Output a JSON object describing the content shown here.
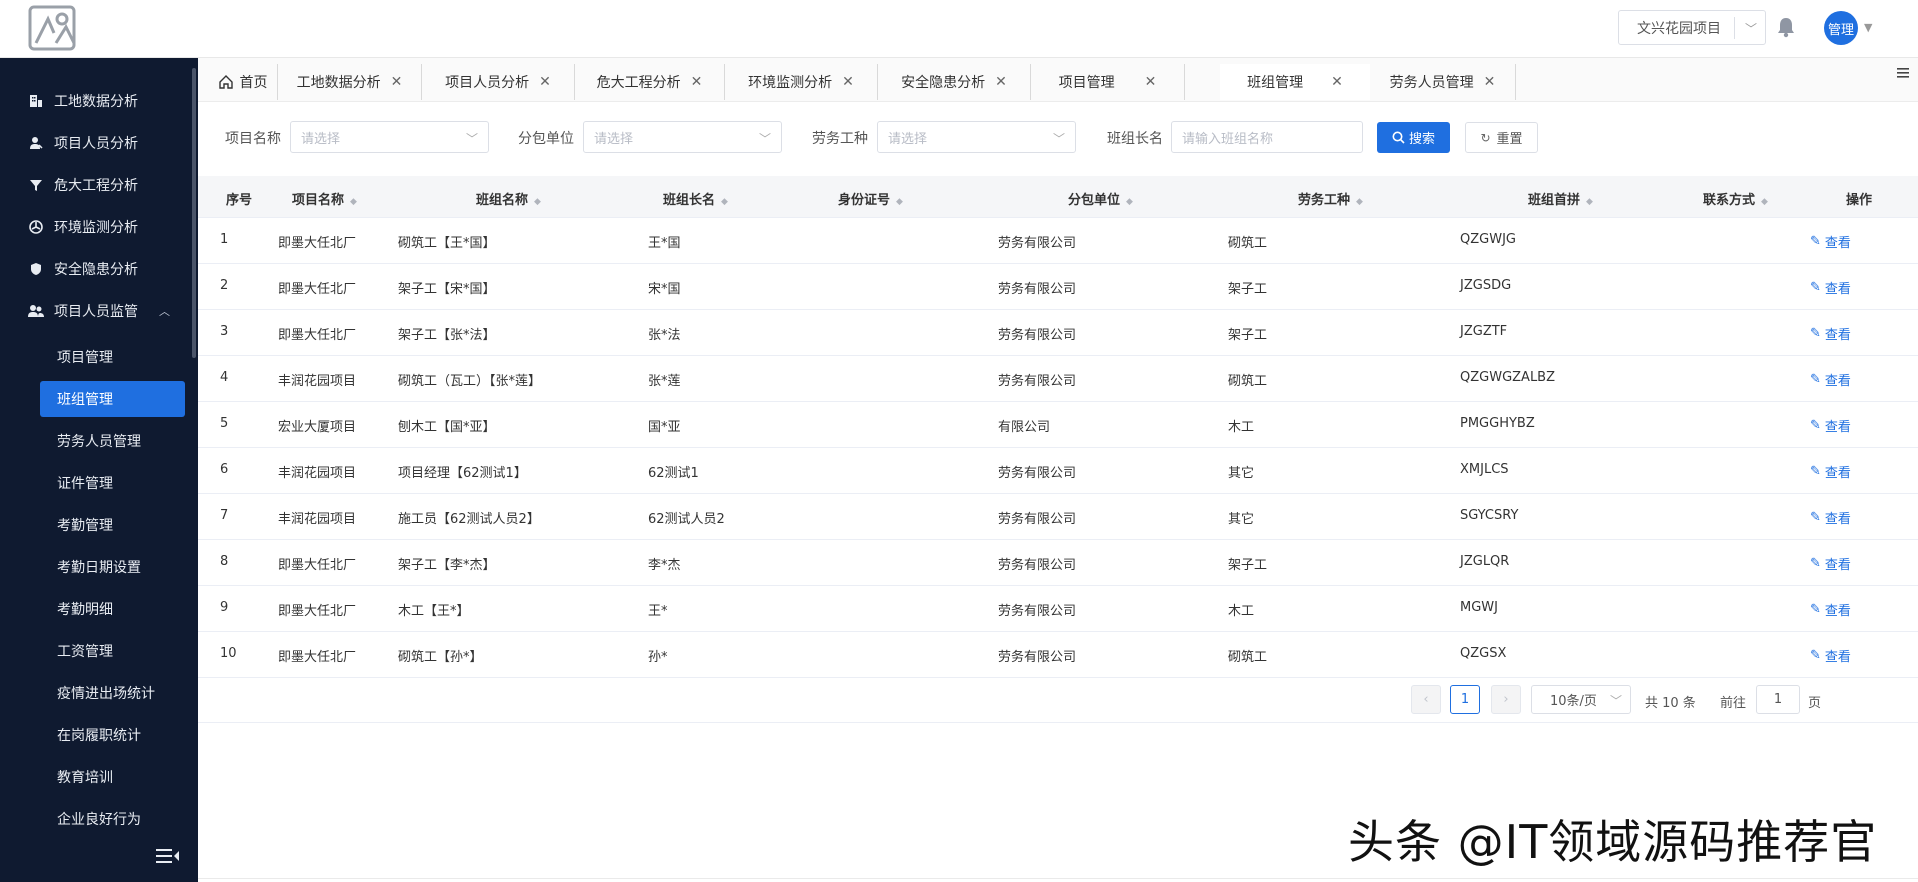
{
  "header": {
    "project_select": "文兴花园项目",
    "avatar_label": "管理",
    "brand_color": "#1f6fe0"
  },
  "sidebar": {
    "items": [
      {
        "label": "工地数据分析",
        "icon": "building-icon"
      },
      {
        "label": "项目人员分析",
        "icon": "person-icon"
      },
      {
        "label": "危大工程分析",
        "icon": "filter-icon"
      },
      {
        "label": "环境监测分析",
        "icon": "fan-icon"
      },
      {
        "label": "安全隐患分析",
        "icon": "shield-icon"
      },
      {
        "label": "项目人员监管",
        "icon": "users-icon"
      }
    ],
    "sub_items": [
      "项目管理",
      "班组管理",
      "劳务人员管理",
      "证件管理",
      "考勤管理",
      "考勤日期设置",
      "考勤明细",
      "工资管理",
      "疫情进出场统计",
      "在岗履职统计",
      "教育培训",
      "企业良好行为"
    ],
    "active_sub": "班组管理"
  },
  "tabs": [
    {
      "label": "首页",
      "closable": false
    },
    {
      "label": "工地数据分析",
      "closable": true
    },
    {
      "label": "项目人员分析",
      "closable": true
    },
    {
      "label": "危大工程分析",
      "closable": true
    },
    {
      "label": "环境监测分析",
      "closable": true
    },
    {
      "label": "安全隐患分析",
      "closable": true
    },
    {
      "label": "项目管理",
      "closable": true
    },
    {
      "label": "班组管理",
      "closable": true,
      "active": true
    },
    {
      "label": "劳务人员管理",
      "closable": true
    }
  ],
  "filters": {
    "project_name_label": "项目名称",
    "project_name_placeholder": "请选择",
    "subcontractor_label": "分包单位",
    "subcontractor_placeholder": "请选择",
    "worktype_label": "劳务工种",
    "worktype_placeholder": "请选择",
    "leader_label": "班组长名",
    "leader_placeholder": "请输入班组名称",
    "search_label": "搜索",
    "reset_label": "重置"
  },
  "table": {
    "headers": [
      "序号",
      "项目名称",
      "班组名称",
      "班组长名",
      "身份证号",
      "分包单位",
      "劳务工种",
      "班组首拼",
      "联系方式",
      "操作"
    ],
    "view_label": "查看",
    "rows": [
      {
        "no": "1",
        "project": "即墨大任北厂",
        "team": "砌筑工【王*国】",
        "leader": "王*国",
        "id": "",
        "sub": "劳务有限公司",
        "type": "砌筑工",
        "pinyin": "QZGWJG",
        "phone": ""
      },
      {
        "no": "2",
        "project": "即墨大任北厂",
        "team": "架子工【宋*国】",
        "leader": "宋*国",
        "id": "",
        "sub": "劳务有限公司",
        "type": "架子工",
        "pinyin": "JZGSDG",
        "phone": ""
      },
      {
        "no": "3",
        "project": "即墨大任北厂",
        "team": "架子工【张*法】",
        "leader": "张*法",
        "id": "",
        "sub": "劳务有限公司",
        "type": "架子工",
        "pinyin": "JZGZTF",
        "phone": ""
      },
      {
        "no": "4",
        "project": "丰润花园项目",
        "team": "砌筑工（瓦工）【张*莲】",
        "leader": "张*莲",
        "id": "",
        "sub": "劳务有限公司",
        "type": "砌筑工",
        "pinyin": "QZGWGZALBZ",
        "phone": ""
      },
      {
        "no": "5",
        "project": "宏业大厦项目",
        "team": "刨木工【国*亚】",
        "leader": "国*亚",
        "id": "",
        "sub": "有限公司",
        "type": "木工",
        "pinyin": "PMGGHYBZ",
        "phone": ""
      },
      {
        "no": "6",
        "project": "丰润花园项目",
        "team": "项目经理【62测试1】",
        "leader": "62测试1",
        "id": "",
        "sub": "劳务有限公司",
        "type": "其它",
        "pinyin": "XMJLCS",
        "phone": ""
      },
      {
        "no": "7",
        "project": "丰润花园项目",
        "team": "施工员【62测试人员2】",
        "leader": "62测试人员2",
        "id": "",
        "sub": "劳务有限公司",
        "type": "其它",
        "pinyin": "SGYCSRY",
        "phone": ""
      },
      {
        "no": "8",
        "project": "即墨大任北厂",
        "team": "架子工【李*杰】",
        "leader": "李*杰",
        "id": "",
        "sub": "劳务有限公司",
        "type": "架子工",
        "pinyin": "JZGLQR",
        "phone": ""
      },
      {
        "no": "9",
        "project": "即墨大任北厂",
        "team": "木工【王*】",
        "leader": "王*",
        "id": "",
        "sub": "劳务有限公司",
        "type": "木工",
        "pinyin": "MGWJ",
        "phone": ""
      },
      {
        "no": "10",
        "project": "即墨大任北厂",
        "team": "砌筑工【孙*】",
        "leader": "孙*",
        "id": "",
        "sub": "劳务有限公司",
        "type": "砌筑工",
        "pinyin": "QZGSX",
        "phone": ""
      }
    ]
  },
  "pagination": {
    "current_page": "1",
    "page_size": "10条/页",
    "total": "共 10 条",
    "goto_label": "前往",
    "goto_value": "1",
    "page_suffix": "页"
  },
  "watermark": "头条 @IT领域源码推荐官"
}
